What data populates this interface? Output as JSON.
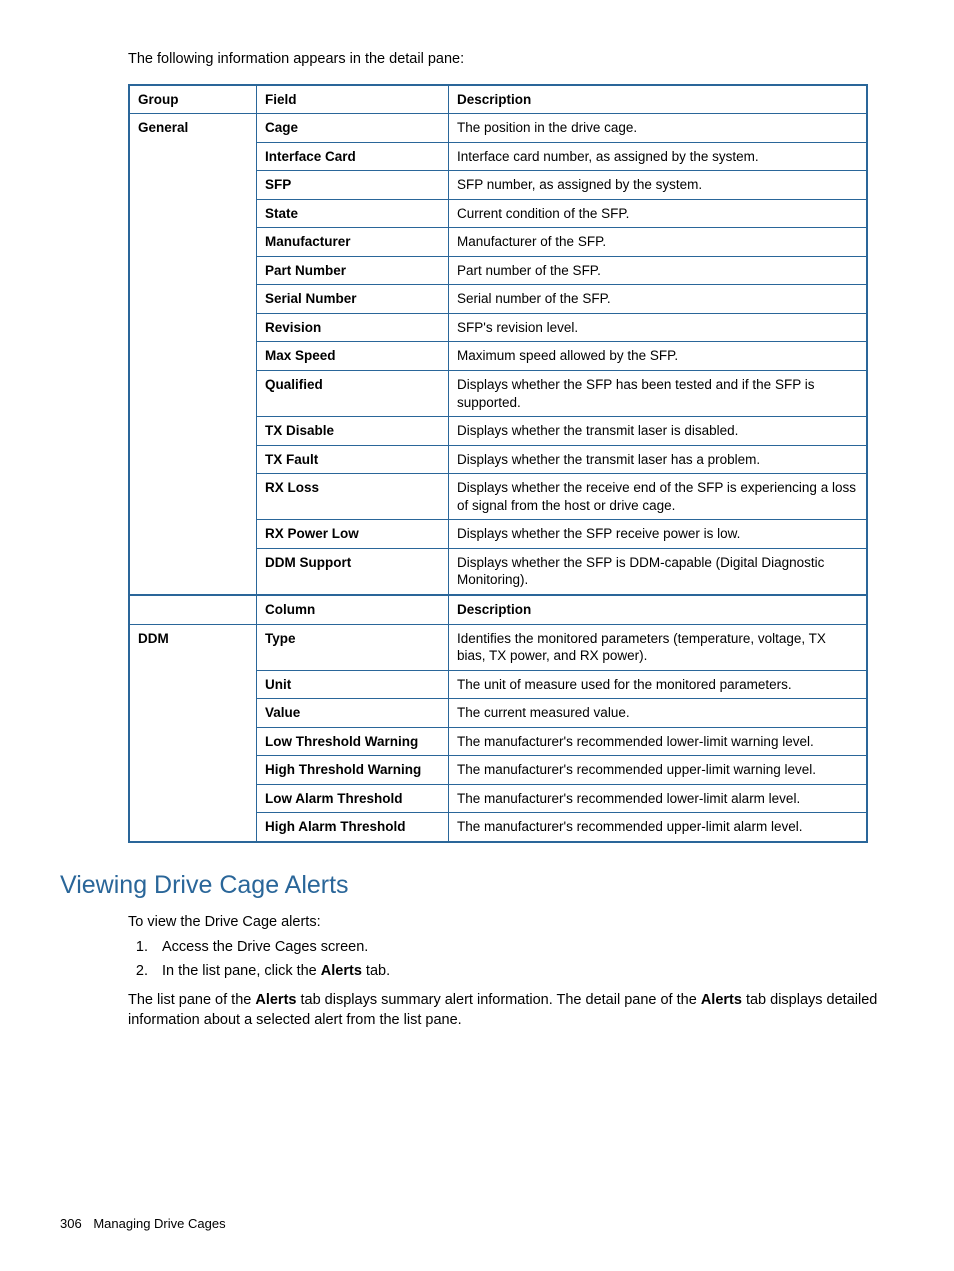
{
  "intro": "The following information appears in the detail pane:",
  "headers1": {
    "group": "Group",
    "field": "Field",
    "desc": "Description"
  },
  "group1": "General",
  "rows1": [
    {
      "field": "Cage",
      "desc": "The position in the drive cage."
    },
    {
      "field": "Interface Card",
      "desc": "Interface card number, as assigned by the system."
    },
    {
      "field": "SFP",
      "desc": "SFP number, as assigned by the system."
    },
    {
      "field": "State",
      "desc": "Current condition of the SFP."
    },
    {
      "field": "Manufacturer",
      "desc": "Manufacturer of the SFP."
    },
    {
      "field": "Part Number",
      "desc": "Part number of the SFP."
    },
    {
      "field": "Serial Number",
      "desc": "Serial number of the SFP."
    },
    {
      "field": "Revision",
      "desc": "SFP's revision level."
    },
    {
      "field": "Max Speed",
      "desc": "Maximum speed allowed by the SFP."
    },
    {
      "field": "Qualified",
      "desc": "Displays whether the SFP has been tested and if the SFP is supported."
    },
    {
      "field": "TX Disable",
      "desc": "Displays whether the transmit laser is disabled."
    },
    {
      "field": "TX Fault",
      "desc": "Displays whether the transmit laser has a problem."
    },
    {
      "field": "RX Loss",
      "desc": "Displays whether the receive end of the SFP is experiencing a loss of signal from the host or drive cage."
    },
    {
      "field": "RX Power Low",
      "desc": "Displays whether the SFP receive power is low."
    },
    {
      "field": "DDM Support",
      "desc": "Displays whether the SFP is DDM-capable (Digital Diagnostic Monitoring)."
    }
  ],
  "headers2": {
    "group": "",
    "field": "Column",
    "desc": "Description"
  },
  "group2": "DDM",
  "rows2": [
    {
      "field": "Type",
      "desc": "Identifies the monitored parameters (temperature, voltage, TX bias, TX power, and RX power)."
    },
    {
      "field": "Unit",
      "desc": "The unit of measure used for the monitored parameters."
    },
    {
      "field": "Value",
      "desc": "The current measured value."
    },
    {
      "field": "Low Threshold Warning",
      "desc": "The manufacturer's recommended lower-limit warning level."
    },
    {
      "field": "High Threshold Warning",
      "desc": "The manufacturer's recommended upper-limit warning level."
    },
    {
      "field": "Low Alarm Threshold",
      "desc": "The manufacturer's recommended lower-limit alarm level."
    },
    {
      "field": "High Alarm Threshold",
      "desc": "The manufacturer's recommended upper-limit alarm level."
    }
  ],
  "section_heading": "Viewing Drive Cage Alerts",
  "para1": "To view the Drive Cage alerts:",
  "step1": "Access the Drive Cages screen.",
  "step2_pre": "In the list pane, click the ",
  "step2_bold": "Alerts",
  "step2_post": " tab.",
  "para2_a": "The list pane of the ",
  "para2_b": "Alerts",
  "para2_c": " tab displays summary alert information. The detail pane of the ",
  "para2_d": "Alerts",
  "para2_e": " tab displays detailed information about a selected alert from the list pane.",
  "footer_page": "306",
  "footer_title": "Managing Drive Cages"
}
